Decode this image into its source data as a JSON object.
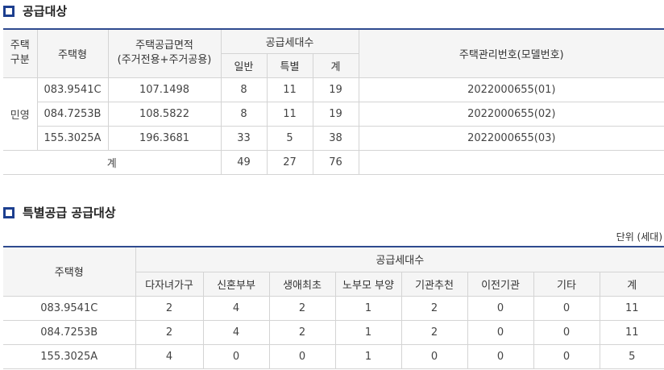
{
  "section1": {
    "title": "공급대상",
    "headers": {
      "category": "주택\n구분",
      "type": "주택형",
      "area": "주택공급면적\n(주거전용+주거공용)",
      "units": "공급세대수",
      "general": "일반",
      "special": "특별",
      "total": "계",
      "mgmt_no": "주택관리번호(모델번호)"
    },
    "category_value": "민영",
    "rows": [
      {
        "type": "083.9541C",
        "area": "107.1498",
        "general": "8",
        "special": "11",
        "total": "19",
        "mgmt_no": "2022000655(01)"
      },
      {
        "type": "084.7253B",
        "area": "108.5822",
        "general": "8",
        "special": "11",
        "total": "19",
        "mgmt_no": "2022000655(02)"
      },
      {
        "type": "155.3025A",
        "area": "196.3681",
        "general": "33",
        "special": "5",
        "total": "38",
        "mgmt_no": "2022000655(03)"
      }
    ],
    "total_row": {
      "label": "계",
      "general": "49",
      "special": "27",
      "total": "76"
    }
  },
  "section2": {
    "title": "특별공급 공급대상",
    "unit": "단위 (세대)",
    "headers": {
      "type": "주택형",
      "units": "공급세대수",
      "cols": [
        "다자녀가구",
        "신혼부부",
        "생애최초",
        "노부모 부양",
        "기관추천",
        "이전기관",
        "기타",
        "계"
      ]
    },
    "rows": [
      {
        "type": "083.9541C",
        "values": [
          "2",
          "4",
          "2",
          "1",
          "2",
          "0",
          "0",
          "11"
        ]
      },
      {
        "type": "084.7253B",
        "values": [
          "2",
          "4",
          "2",
          "1",
          "2",
          "0",
          "0",
          "11"
        ]
      },
      {
        "type": "155.3025A",
        "values": [
          "4",
          "0",
          "0",
          "1",
          "0",
          "0",
          "0",
          "5"
        ]
      }
    ]
  }
}
